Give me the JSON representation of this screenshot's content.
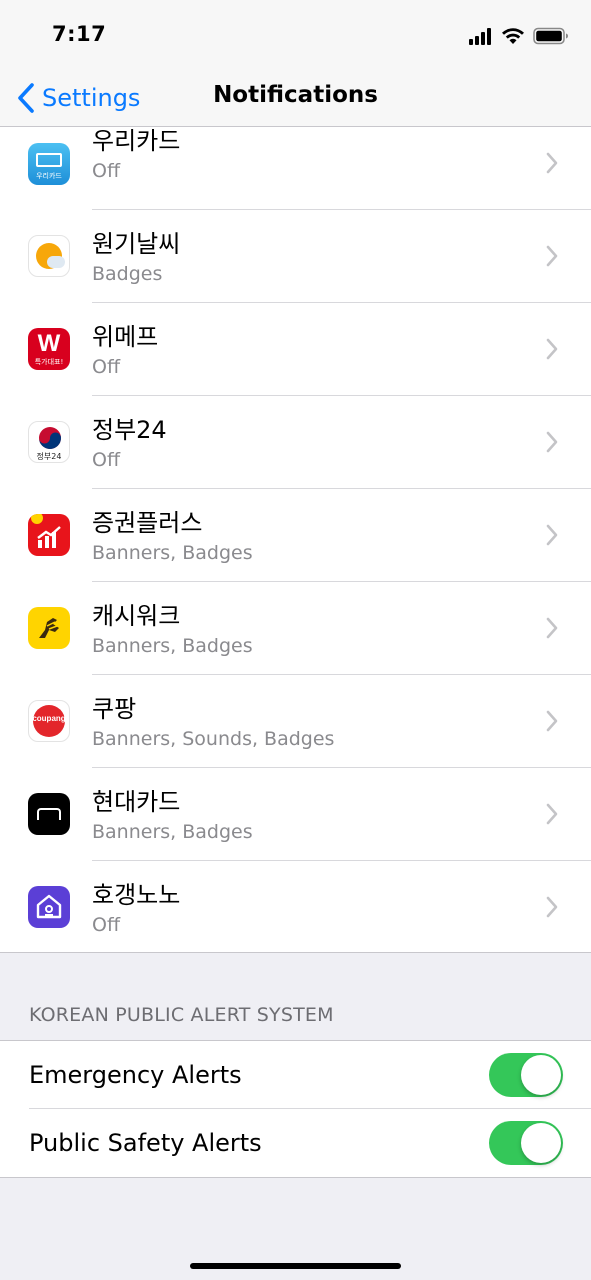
{
  "status_bar": {
    "time": "7:17"
  },
  "nav": {
    "back_label": "Settings",
    "title": "Notifications"
  },
  "apps": [
    {
      "name": "우리카드",
      "subtitle": "Off",
      "icon": "woori-card-icon",
      "color": "#2fa7e8"
    },
    {
      "name": "원기날씨",
      "subtitle": "Badges",
      "icon": "wongi-weather-icon",
      "color": "#f5a623"
    },
    {
      "name": "위메프",
      "subtitle": "Off",
      "icon": "wemakeprice-icon",
      "color": "#d8001e"
    },
    {
      "name": "정부24",
      "subtitle": "Off",
      "icon": "gov24-icon",
      "color": "#ffffff"
    },
    {
      "name": "증권플러스",
      "subtitle": "Banners, Badges",
      "icon": "stock-plus-icon",
      "color": "#e8141b"
    },
    {
      "name": "캐시워크",
      "subtitle": "Banners, Badges",
      "icon": "cashwalk-icon",
      "color": "#ffd400"
    },
    {
      "name": "쿠팡",
      "subtitle": "Banners, Sounds, Badges",
      "icon": "coupang-icon",
      "color": "#e3262b"
    },
    {
      "name": "현대카드",
      "subtitle": "Banners, Badges",
      "icon": "hyundai-card-icon",
      "color": "#000000"
    },
    {
      "name": "호갱노노",
      "subtitle": "Off",
      "icon": "hogangnono-icon",
      "color": "#5b3fd6"
    }
  ],
  "app_icon_text": {
    "woori": "우리카드",
    "wemakeprice_logo": "W",
    "wemakeprice_sub": "특가대표!",
    "gov24": "정부24",
    "coupang": "coupang"
  },
  "alerts_section": {
    "header": "KOREAN PUBLIC ALERT SYSTEM",
    "items": [
      {
        "label": "Emergency Alerts",
        "enabled": true
      },
      {
        "label": "Public Safety Alerts",
        "enabled": true
      }
    ]
  },
  "colors": {
    "accent": "#0a7aff",
    "toggle_on": "#34c759",
    "background": "#efeff4"
  }
}
